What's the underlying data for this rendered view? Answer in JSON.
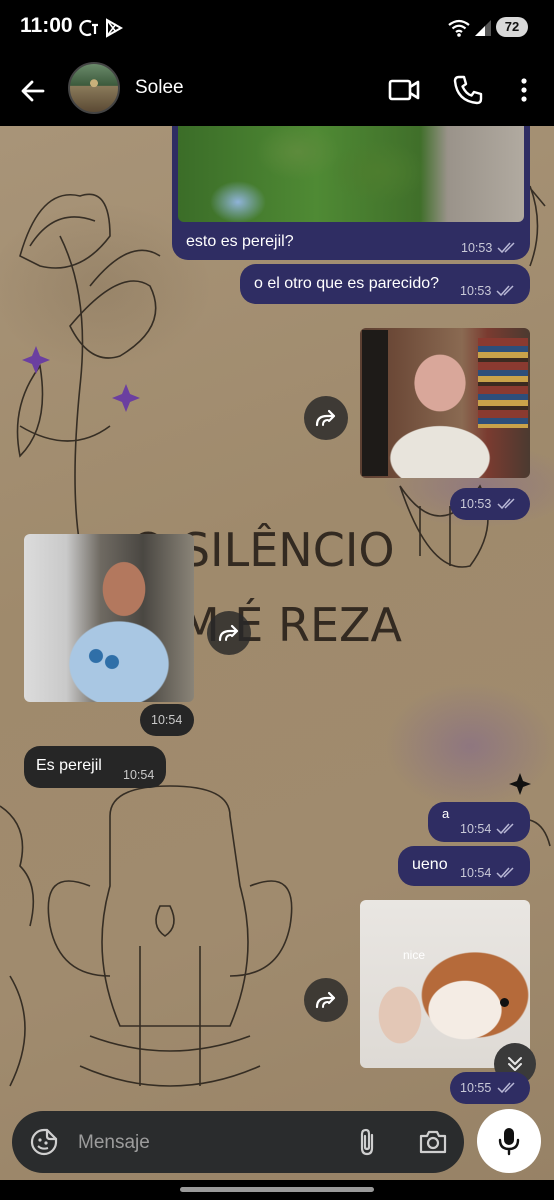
{
  "status_bar": {
    "time": "11:00",
    "battery": "72",
    "icons": [
      "notification-ct-icon",
      "play-store-icon",
      "wifi-icon",
      "signal-icon",
      "battery-icon"
    ]
  },
  "header": {
    "contact_name": "Solee",
    "icons": [
      "back-arrow-icon",
      "video-call-icon",
      "phone-call-icon",
      "more-options-icon"
    ]
  },
  "wallpaper": {
    "text_line1": "O SILÊNCIO",
    "text_line2": "M É REZA"
  },
  "messages": [
    {
      "dir": "out",
      "text": "esto es perejil?",
      "time": "10:53",
      "has_photo": true
    },
    {
      "dir": "out",
      "text": "o el otro que es parecido?",
      "time": "10:53"
    },
    {
      "dir": "out",
      "type": "photo",
      "time": "10:53"
    },
    {
      "dir": "in",
      "type": "photo",
      "time": "10:54"
    },
    {
      "dir": "in",
      "text": "Es perejil",
      "time": "10:54"
    },
    {
      "dir": "out",
      "text": "a",
      "time": "10:54"
    },
    {
      "dir": "out",
      "text": "ueno",
      "time": "10:54"
    },
    {
      "dir": "out",
      "type": "photo",
      "caption": "nice",
      "time": "10:55"
    }
  ],
  "composer": {
    "placeholder": "Mensaje",
    "icons": [
      "sticker-icon",
      "attach-icon",
      "camera-icon",
      "microphone-icon"
    ]
  },
  "colors": {
    "outgoing_bubble": "#2f2d63",
    "incoming_bubble": "#262626",
    "wallpaper": "#a08b6e"
  }
}
